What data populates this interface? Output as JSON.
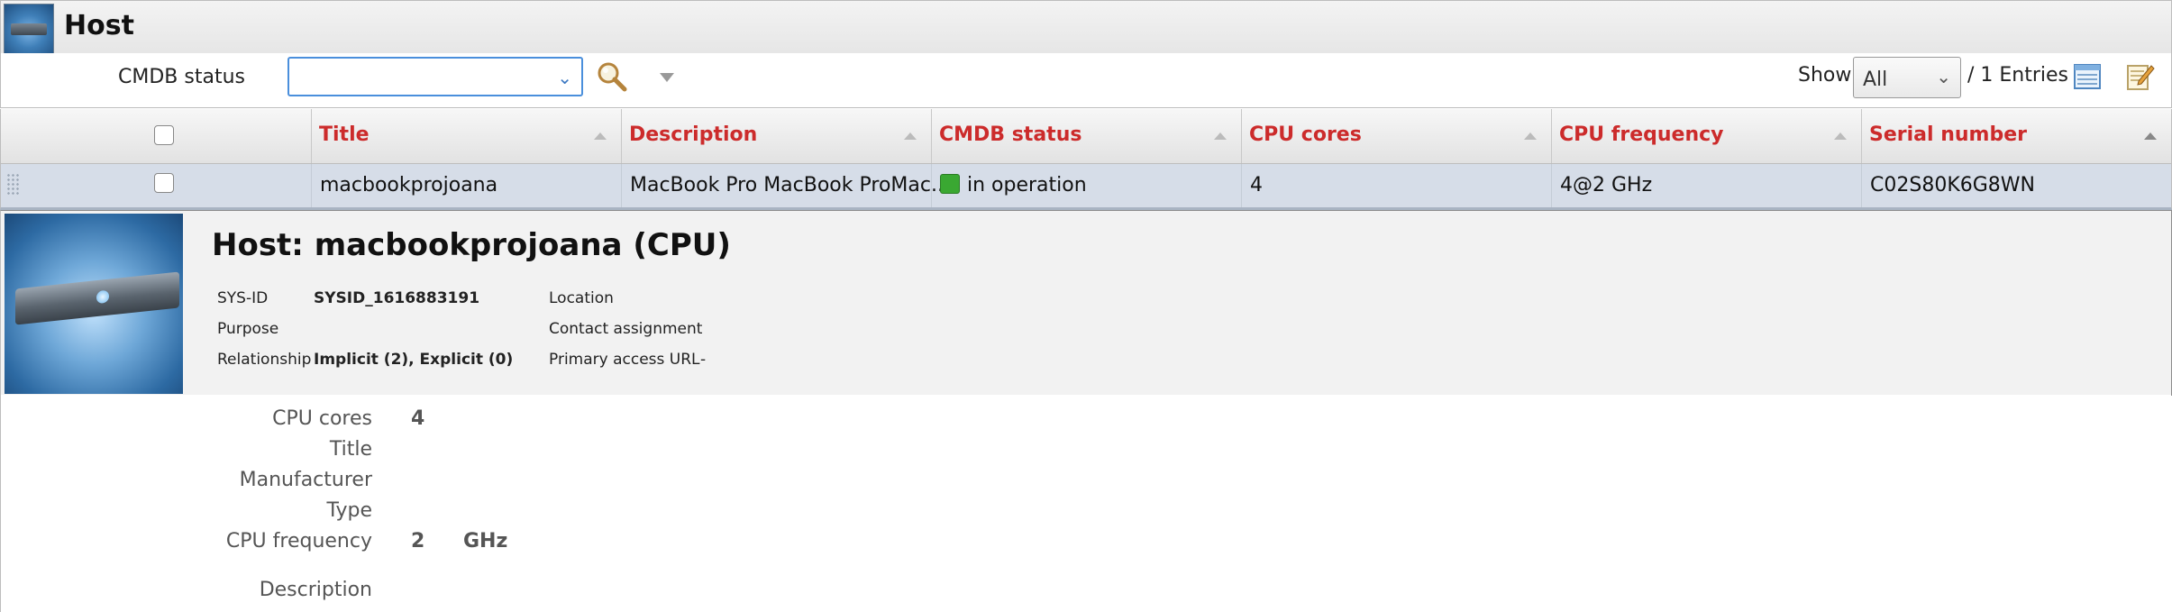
{
  "header": {
    "title": "Host",
    "logo_icon": "server-icon"
  },
  "filter": {
    "label": "CMDB status",
    "value": "",
    "search_icon": "magnifier-icon",
    "show_label": "Show",
    "show_value": "All",
    "entries": "/ 1 Entries"
  },
  "table": {
    "columns": [
      {
        "label": "Title"
      },
      {
        "label": "Description"
      },
      {
        "label": "CMDB status"
      },
      {
        "label": "CPU cores"
      },
      {
        "label": "CPU frequency"
      },
      {
        "label": "Serial number"
      }
    ],
    "rows": [
      {
        "title": "macbookprojoana",
        "description": "MacBook Pro MacBook ProMac...",
        "cmdb_status": "in operation",
        "status_color": "#3aa832",
        "cpu_cores": "4",
        "cpu_frequency": "4@2 GHz",
        "serial": "C02S80K6G8WN"
      }
    ]
  },
  "detail": {
    "title": "Host: macbookprojoana (CPU)",
    "sysid_label": "SYS-ID",
    "sysid_value": "SYSID_1616883191",
    "purpose_label": "Purpose",
    "relationship_label": "Relationship",
    "relationship_value": "Implicit (2), Explicit (0)",
    "location_label": "Location",
    "contact_label": "Contact assignment",
    "url_label": "Primary access URL",
    "url_value": "-"
  },
  "form": {
    "cpu_cores_label": "CPU cores",
    "cpu_cores_value": "4",
    "title_label": "Title",
    "manufacturer_label": "Manufacturer",
    "type_label": "Type",
    "cpu_frequency_label": "CPU frequency",
    "cpu_frequency_value": "2",
    "cpu_frequency_unit": "GHz",
    "description_label": "Description"
  },
  "colors": {
    "header_text": "#cc2b2b",
    "row_selected": "#d6dde8",
    "accent": "#4a8fdc"
  }
}
